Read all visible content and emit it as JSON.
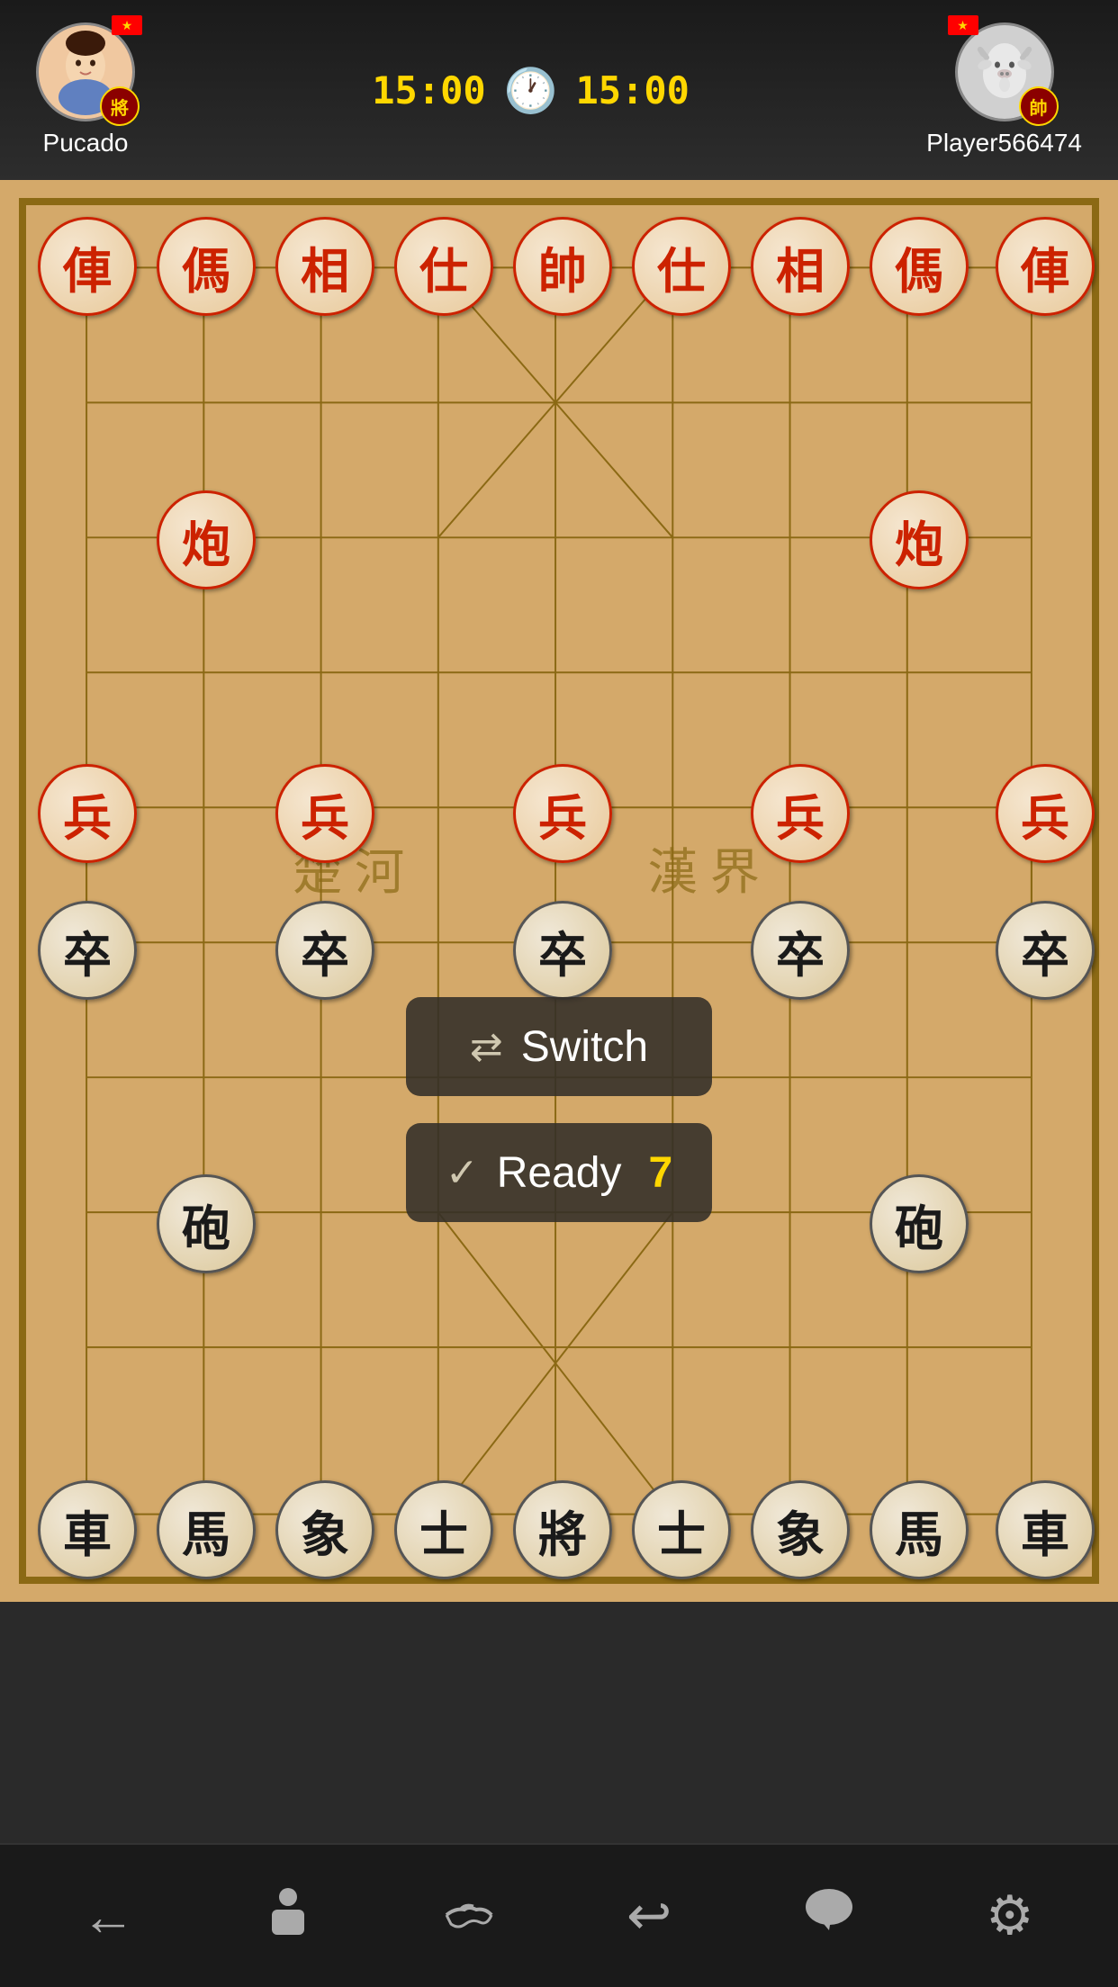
{
  "header": {
    "player1": {
      "name": "Pucado",
      "rank_char": "將",
      "flag": "🇻🇳",
      "avatar_type": "female"
    },
    "player2": {
      "name": "Player566474",
      "rank_char": "帥",
      "flag": "🇻🇳",
      "avatar_type": "male"
    },
    "timer1": "15:00",
    "timer2": "15:00"
  },
  "board": {
    "cols": 9,
    "rows": 10,
    "red_pieces": [
      {
        "char": "俥",
        "col": 0,
        "row": 0,
        "side": "red"
      },
      {
        "char": "傌",
        "col": 1,
        "row": 0,
        "side": "red"
      },
      {
        "char": "相",
        "col": 2,
        "row": 0,
        "side": "red"
      },
      {
        "char": "仕",
        "col": 3,
        "row": 0,
        "side": "red"
      },
      {
        "char": "帥",
        "col": 4,
        "row": 0,
        "side": "red"
      },
      {
        "char": "仕",
        "col": 5,
        "row": 0,
        "side": "red"
      },
      {
        "char": "相",
        "col": 6,
        "row": 0,
        "side": "red"
      },
      {
        "char": "傌",
        "col": 7,
        "row": 0,
        "side": "red"
      },
      {
        "char": "俥",
        "col": 8,
        "row": 0,
        "side": "red"
      },
      {
        "char": "炮",
        "col": 1,
        "row": 2,
        "side": "red"
      },
      {
        "char": "炮",
        "col": 7,
        "row": 2,
        "side": "red"
      },
      {
        "char": "兵",
        "col": 0,
        "row": 4,
        "side": "red"
      },
      {
        "char": "兵",
        "col": 2,
        "row": 4,
        "side": "red"
      },
      {
        "char": "兵",
        "col": 4,
        "row": 4,
        "side": "red"
      },
      {
        "char": "兵",
        "col": 6,
        "row": 4,
        "side": "red"
      },
      {
        "char": "兵",
        "col": 8,
        "row": 4,
        "side": "red"
      }
    ],
    "black_pieces": [
      {
        "char": "車",
        "col": 0,
        "row": 9,
        "side": "black"
      },
      {
        "char": "馬",
        "col": 1,
        "row": 9,
        "side": "black"
      },
      {
        "char": "象",
        "col": 2,
        "row": 9,
        "side": "black"
      },
      {
        "char": "士",
        "col": 3,
        "row": 9,
        "side": "black"
      },
      {
        "char": "將",
        "col": 4,
        "row": 9,
        "side": "black"
      },
      {
        "char": "士",
        "col": 5,
        "row": 9,
        "side": "black"
      },
      {
        "char": "象",
        "col": 6,
        "row": 9,
        "side": "black"
      },
      {
        "char": "馬",
        "col": 7,
        "row": 9,
        "side": "black"
      },
      {
        "char": "車",
        "col": 8,
        "row": 9,
        "side": "black"
      },
      {
        "char": "砲",
        "col": 1,
        "row": 7,
        "side": "black"
      },
      {
        "char": "砲",
        "col": 7,
        "row": 7,
        "side": "black"
      },
      {
        "char": "卒",
        "col": 0,
        "row": 5,
        "side": "black"
      },
      {
        "char": "卒",
        "col": 2,
        "row": 5,
        "side": "black"
      },
      {
        "char": "卒",
        "col": 4,
        "row": 5,
        "side": "black"
      },
      {
        "char": "卒",
        "col": 6,
        "row": 5,
        "side": "black"
      },
      {
        "char": "卒",
        "col": 8,
        "row": 5,
        "side": "black"
      }
    ]
  },
  "overlay": {
    "switch_label": "Switch",
    "ready_label": "Ready",
    "ready_count": "7"
  },
  "toolbar": {
    "buttons": [
      {
        "name": "back",
        "icon": "←"
      },
      {
        "name": "player",
        "icon": "🚶"
      },
      {
        "name": "handshake",
        "icon": "🤝"
      },
      {
        "name": "undo",
        "icon": "↩"
      },
      {
        "name": "chat",
        "icon": "💬"
      },
      {
        "name": "settings",
        "icon": "⚙"
      }
    ]
  }
}
